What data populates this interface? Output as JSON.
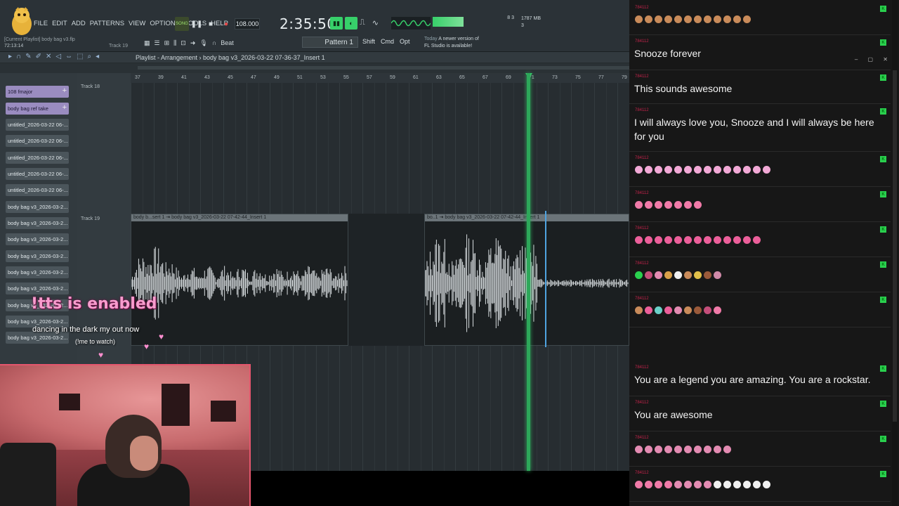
{
  "fl": {
    "menu": [
      "FILE",
      "EDIT",
      "ADD",
      "PATTERNS",
      "VIEW",
      "OPTIONS",
      "TOOLS",
      "HELP"
    ],
    "song_label": "[Current Playlist] body bag v3.flp",
    "song_position_small": "72:13:14",
    "track_mini": "Track 19",
    "mode_badge": "SONG",
    "tempo": "108.000",
    "time": "2:35:50",
    "time_ms": "",
    "poly": "8\n3",
    "mem": "1787 MB\n3",
    "snap_label": "Beat",
    "pattern": "Pattern 1",
    "mods": [
      "Shift",
      "Cmd",
      "Opt"
    ],
    "news_line1_label": "Today",
    "news_line1": "A newer version of",
    "news_line2": "FL Studio is available!"
  },
  "playlist": {
    "crumb": "Playlist - Arrangement › body bag v3_2026-03-22 07-36-37_Insert 1",
    "ruler": [
      "37",
      "39",
      "41",
      "43",
      "45",
      "47",
      "49",
      "51",
      "53",
      "55",
      "57",
      "59",
      "61",
      "63",
      "65",
      "67",
      "69",
      "71",
      "73",
      "75",
      "77",
      "79"
    ],
    "picker": [
      {
        "label": "108 fmajor",
        "selected": true,
        "plus": true
      },
      {
        "label": "body bag ref take",
        "selected": true,
        "plus": true
      },
      {
        "label": "untitled_2026-03-22 06-..."
      },
      {
        "label": "untitled_2026-03-22 06-..."
      },
      {
        "label": "untitled_2026-03-22 06-..."
      },
      {
        "label": "untitled_2026-03-22 06-..."
      },
      {
        "label": "untitled_2026-03-22 06-..."
      },
      {
        "label": "body bag v3_2026-03-2..."
      },
      {
        "label": "body bag v3_2026-03-2..."
      },
      {
        "label": "body bag v3_2026-03-2..."
      },
      {
        "label": "body bag v3_2026-03-2..."
      },
      {
        "label": "body bag v3_2026-03-2..."
      },
      {
        "label": "body bag v3_2026-03-2..."
      },
      {
        "label": "body bag v3_2026-03-2..."
      },
      {
        "label": "body bag v3_2026-03-2..."
      },
      {
        "label": "body bag v3_2026-03-2..."
      }
    ],
    "track_top": "Track 18",
    "track_main": "Track 19",
    "clips": [
      {
        "title": "body b...sert 1 ⇥ body bag v3_2026-03-22 07-42-44_Insert 1"
      },
      {
        "title": "bo..1 ⇥ body bag v3_2026-03-22 07-42-44_Insert 1"
      }
    ]
  },
  "overlay": {
    "tts": "!tts is enabled",
    "song_now": "dancing in the dark my out now",
    "watch": "(!me to watch)"
  },
  "chat": {
    "username": "784112",
    "messages": [
      {
        "text": "",
        "emotes": [
          "#c98b5a",
          "#c98b5a",
          "#c98b5a",
          "#c98b5a",
          "#c98b5a",
          "#c98b5a",
          "#c98b5a",
          "#c98b5a",
          "#c98b5a",
          "#c98b5a",
          "#c98b5a",
          "#c98b5a"
        ]
      },
      {
        "text": "Snooze forever"
      },
      {
        "text": "This sounds awesome"
      },
      {
        "text": "I will always love you, Snooze and I will always be here for you"
      },
      {
        "text": "",
        "emotes": [
          "#f2a9d6",
          "#f2a9d6",
          "#f2a9d6",
          "#f2a9d6",
          "#f2a9d6",
          "#f2a9d6",
          "#f2a9d6",
          "#f2a9d6",
          "#f2a9d6",
          "#f2a9d6",
          "#f2a9d6",
          "#f2a9d6",
          "#f2a9d6",
          "#f2a9d6"
        ]
      },
      {
        "text": "",
        "emotes": [
          "#f07aa8",
          "#f07aa8",
          "#f07aa8",
          "#f07aa8",
          "#f07aa8",
          "#f07aa8",
          "#f07aa8"
        ]
      },
      {
        "text": "",
        "emotes": [
          "#ec5f9a",
          "#ec5f9a",
          "#ec5f9a",
          "#ec5f9a",
          "#ec5f9a",
          "#ec5f9a",
          "#ec5f9a",
          "#ec5f9a",
          "#ec5f9a",
          "#ec5f9a",
          "#ec5f9a",
          "#ec5f9a",
          "#ec5f9a"
        ]
      },
      {
        "text": "",
        "emotes": [
          "#2ad04e",
          "#c44e7a",
          "#e38bb2",
          "#d9a04a",
          "#f0f0f0",
          "#c98b5a",
          "#e2c04a",
          "#9a5a3a",
          "#d08aa8"
        ]
      },
      {
        "text": "",
        "emotes": [
          "#c98b5a",
          "#ec5f9a",
          "#6ad0c8",
          "#ec5f9a",
          "#e38bb2",
          "#c98b5a",
          "#9a5a3a",
          "#c44e7a",
          "#f07aa8"
        ]
      },
      {
        "text": "You are a legend you are amazing. You are a rockstar."
      },
      {
        "text": "You are awesome"
      },
      {
        "text": "",
        "emotes": [
          "#e38bb2",
          "#e38bb2",
          "#e38bb2",
          "#e38bb2",
          "#e38bb2",
          "#e38bb2",
          "#e38bb2",
          "#e38bb2",
          "#e38bb2",
          "#e38bb2"
        ]
      },
      {
        "text": "",
        "emotes": [
          "#f07aa8",
          "#f07aa8",
          "#f07aa8",
          "#f07aa8",
          "#e38bb2",
          "#e38bb2",
          "#e38bb2",
          "#e38bb2",
          "#f0f0f0",
          "#f0f0f0",
          "#f0f0f0",
          "#f0f0f0",
          "#f0f0f0",
          "#f0f0f0"
        ]
      }
    ]
  },
  "colors": {
    "accent_green": "#37d06a",
    "playhead": "#2da85a",
    "cursor": "#4fa3e0",
    "tts_pink": "#f79ccd",
    "chat_user": "#c2234a",
    "kick_badge": "#2ad04e"
  }
}
